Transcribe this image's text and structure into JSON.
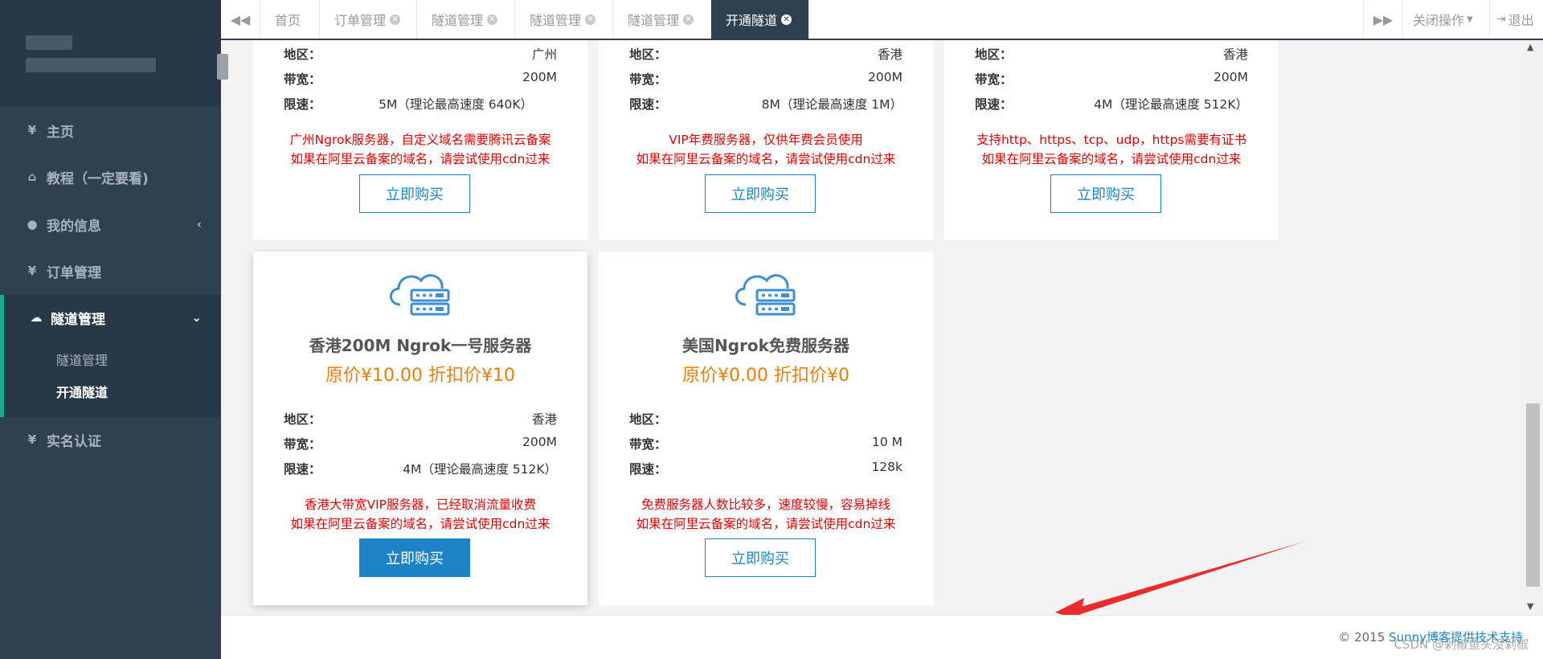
{
  "sidebar": {
    "items": [
      {
        "icon": "yen-icon",
        "glyph": "¥",
        "label": "主页"
      },
      {
        "icon": "home-icon",
        "glyph": "⌂",
        "label": "教程（一定要看)"
      },
      {
        "icon": "user-icon",
        "glyph": "●",
        "label": "我的信息"
      },
      {
        "icon": "yen-icon",
        "glyph": "¥",
        "label": "订单管理"
      },
      {
        "icon": "cloud-icon",
        "glyph": "☁",
        "label": "隧道管理"
      },
      {
        "icon": "yen-icon",
        "glyph": "¥",
        "label": "实名认证"
      }
    ],
    "sub_items": [
      "隧道管理",
      "开通隧道"
    ]
  },
  "tabbar": {
    "tabs": [
      "首页",
      "订单管理",
      "隧道管理",
      "隧道管理",
      "隧道管理",
      "开通隧道"
    ],
    "close_ops": "关闭操作",
    "logout": "退出"
  },
  "cards_top": [
    {
      "region_label": "地区：",
      "region": "广州",
      "bw_label": "带宽：",
      "bw": "200M",
      "limit_label": "限速：",
      "limit": "5M（理论最高速度 640K）",
      "note1": "广州Ngrok服务器，自定义域名需要腾讯云备案",
      "note2": "如果在阿里云备案的域名，请尝试使用cdn过来",
      "buy": "立即购买"
    },
    {
      "region_label": "地区：",
      "region": "香港",
      "bw_label": "带宽：",
      "bw": "200M",
      "limit_label": "限速：",
      "limit": "8M（理论最高速度 1M）",
      "note1": "VIP年费服务器，仅供年费会员使用",
      "note2": "如果在阿里云备案的域名，请尝试使用cdn过来",
      "buy": "立即购买"
    },
    {
      "region_label": "地区：",
      "region": "香港",
      "bw_label": "带宽：",
      "bw": "200M",
      "limit_label": "限速：",
      "limit": "4M（理论最高速度 512K）",
      "note1": "支持http、https、tcp、udp，https需要有证书",
      "note2": "如果在阿里云备案的域名，请尝试使用cdn过来",
      "buy": "立即购买"
    }
  ],
  "cards_bottom": [
    {
      "title": "香港200M Ngrok一号服务器",
      "price": "原价¥10.00   折扣价¥10",
      "region_label": "地区：",
      "region": "香港",
      "bw_label": "带宽：",
      "bw": "200M",
      "limit_label": "限速：",
      "limit": "4M（理论最高速度 512K）",
      "note1": "香港大带宽VIP服务器，已经取消流量收费",
      "note2": "如果在阿里云备案的域名，请尝试使用cdn过来",
      "buy": "立即购买"
    },
    {
      "title": "美国Ngrok免费服务器",
      "price": "原价¥0.00   折扣价¥0",
      "region_label": "地区：",
      "region": "",
      "bw_label": "带宽：",
      "bw": "10 M",
      "limit_label": "限速：",
      "limit": "128k",
      "note1": "免费服务器人数比较多，速度较慢，容易掉线",
      "note2": "如果在阿里云备案的域名，请尝试使用cdn过来",
      "buy": "立即购买"
    }
  ],
  "footer": {
    "copyright": "© 2015 ",
    "link": "Sunny博客提供技术支持"
  },
  "watermark": "CSDN @剁椒鱼头没剁椒",
  "colors": {
    "sidebar": "#2f4050",
    "accent": "#1c84c6",
    "price": "#f57c00",
    "note": "#e60000",
    "active_border": "#19aa8d"
  }
}
